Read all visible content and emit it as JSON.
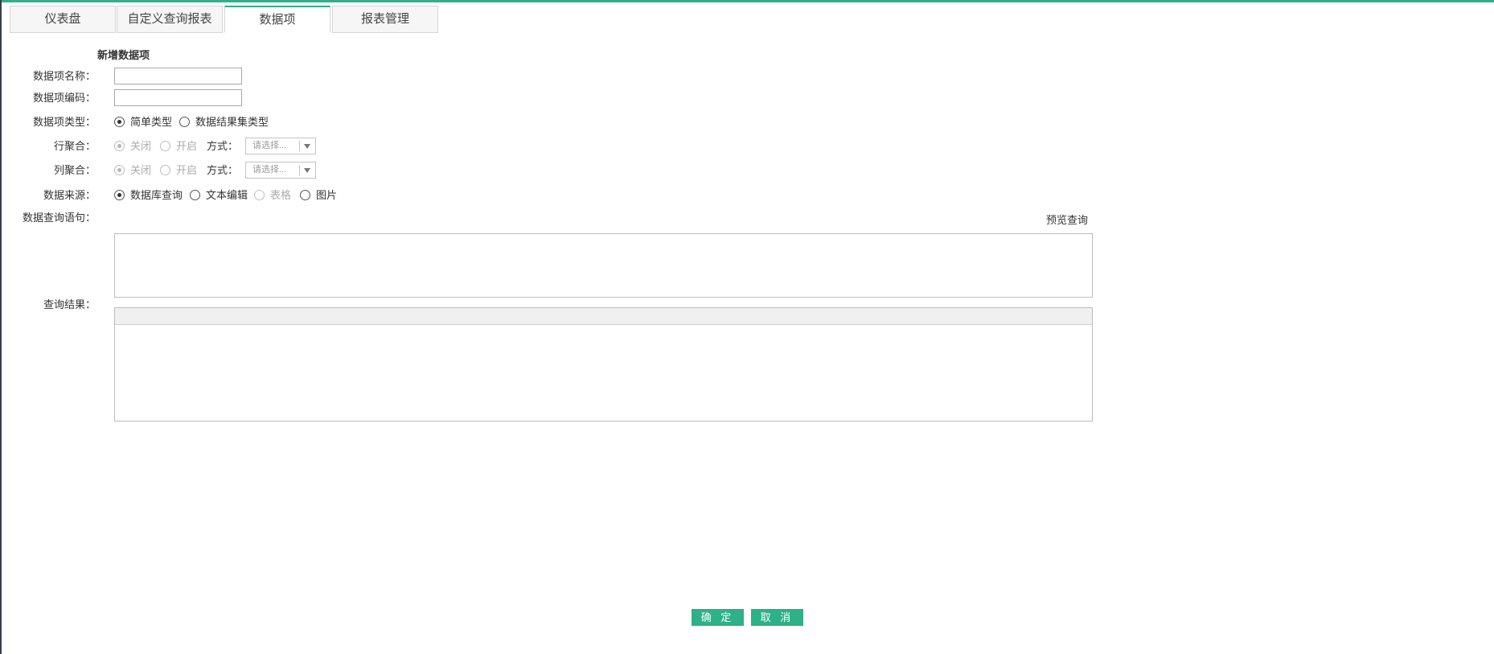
{
  "tabs": [
    {
      "label": "仪表盘"
    },
    {
      "label": "自定义查询报表"
    },
    {
      "label": "数据项"
    },
    {
      "label": "报表管理"
    }
  ],
  "active_tab": "数据项",
  "form": {
    "title": "新增数据项",
    "name": {
      "label": "数据项名称：",
      "value": ""
    },
    "code": {
      "label": "数据项编码：",
      "value": ""
    },
    "type": {
      "label": "数据项类型：",
      "options": [
        "简单类型",
        "数据结果集类型"
      ],
      "selected": "简单类型"
    },
    "row_agg": {
      "label": "行聚合：",
      "options": [
        "关闭",
        "开启"
      ],
      "selected": "关闭",
      "mode_label": "方式：",
      "mode_placeholder": "请选择..."
    },
    "col_agg": {
      "label": "列聚合：",
      "options": [
        "关闭",
        "开启"
      ],
      "selected": "关闭",
      "mode_label": "方式：",
      "mode_placeholder": "请选择..."
    },
    "source": {
      "label": "数据来源：",
      "options": [
        "数据库查询",
        "文本编辑",
        "表格",
        "图片"
      ],
      "selected": "数据库查询"
    },
    "query": {
      "label": "数据查询语句：",
      "preview": "预览查询",
      "value": ""
    },
    "result": {
      "label": "查询结果："
    }
  },
  "buttons": {
    "confirm": "确 定",
    "cancel": "取 消"
  },
  "colors": {
    "accent": "#2eb088"
  }
}
